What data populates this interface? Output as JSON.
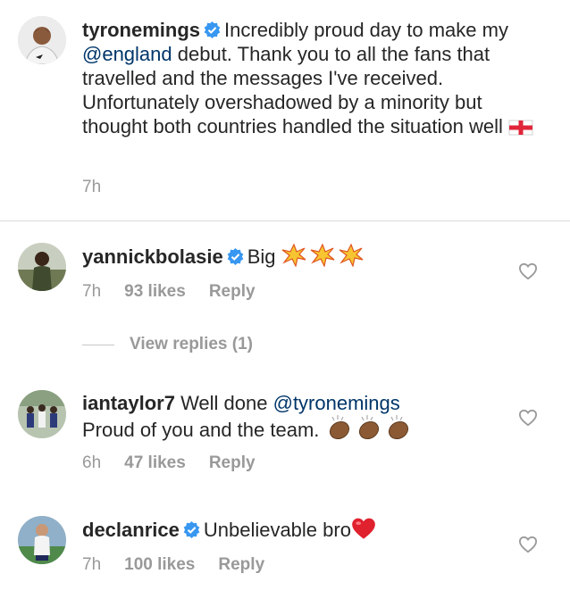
{
  "caption": {
    "username": "tyronemings",
    "text_before_mention": "Incredibly proud day to make my ",
    "mention": "@england",
    "text_after_mention": " debut. Thank you to all the fans that travelled and the messages I've received. Unfortunately overshadowed by a minority but thought both countries handled the situation well",
    "time": "7h"
  },
  "comments": [
    {
      "username": "yannickbolasie",
      "text": "Big",
      "time": "7h",
      "likes": "93 likes",
      "reply": "Reply",
      "view_replies": "View replies (1)"
    },
    {
      "username": "iantaylor7",
      "text_before_mention": "Well done ",
      "mention": "@tyronemings",
      "text_line2": "Proud of you and the team.",
      "time": "6h",
      "likes": "47 likes",
      "reply": "Reply"
    },
    {
      "username": "declanrice",
      "text": "Unbelievable bro",
      "time": "7h",
      "likes": "100 likes",
      "reply": "Reply"
    }
  ],
  "colors": {
    "text": "#262626",
    "meta": "#999999",
    "mention": "#003569",
    "verified": "#3897f0",
    "divider": "#dbdbdb"
  },
  "icons": [
    "verified-badge-icon",
    "england-flag-emoji",
    "collision-emoji",
    "clapping-hands-emoji",
    "red-heart-emoji",
    "heart-outline-icon"
  ]
}
